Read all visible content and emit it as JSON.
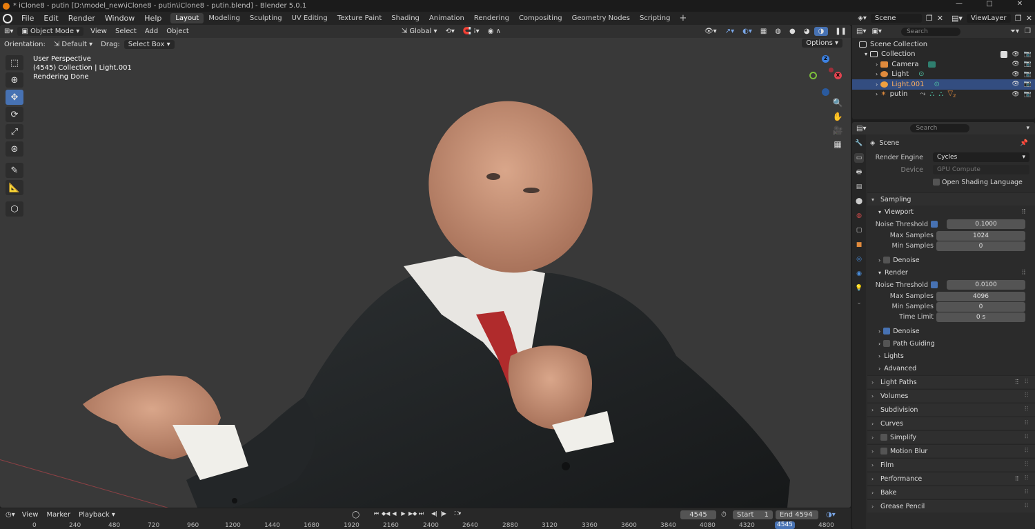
{
  "window": {
    "title": "* iClone8 - putin [D:\\model_new\\iClone8 - putin\\iClone8 - putin.blend] - Blender 5.0.1",
    "controls": [
      "—",
      "□",
      "✕"
    ]
  },
  "menu": [
    "File",
    "Edit",
    "Render",
    "Window",
    "Help"
  ],
  "workspaces": [
    "Layout",
    "Modeling",
    "Sculpting",
    "UV Editing",
    "Texture Paint",
    "Shading",
    "Animation",
    "Rendering",
    "Compositing",
    "Geometry Nodes",
    "Scripting"
  ],
  "active_workspace": "Layout",
  "scene": "Scene",
  "view_layer": "ViewLayer",
  "viewport": {
    "mode": "Object Mode",
    "menus": [
      "View",
      "Select",
      "Add",
      "Object"
    ],
    "transform_orientation": "Global",
    "orientation_label": "Orientation:",
    "orientation_value": "Default",
    "drag_label": "Drag:",
    "drag_value": "Select Box",
    "options": "Options",
    "info_perspective": "User Perspective",
    "info_collection": "(4545) Collection | Light.001",
    "info_status": "Rendering Done",
    "gizmo_axes": [
      "Z",
      "X",
      "Y"
    ]
  },
  "outliner": {
    "search_placeholder": "Search",
    "root": "Scene Collection",
    "collection": "Collection",
    "items": [
      {
        "name": "Camera"
      },
      {
        "name": "Light"
      },
      {
        "name": "Light.001",
        "selected": true
      },
      {
        "name": "putin",
        "badge": "2"
      }
    ]
  },
  "properties": {
    "search_placeholder": "Search",
    "context": "Scene",
    "render_engine_label": "Render Engine",
    "render_engine": "Cycles",
    "device_label": "Device",
    "device": "GPU Compute",
    "osl_label": "Open Shading Language",
    "sampling": "Sampling",
    "viewport_sub": "Viewport",
    "render_sub": "Render",
    "noise_threshold_label": "Noise Threshold",
    "max_samples_label": "Max Samples",
    "min_samples_label": "Min Samples",
    "time_limit_label": "Time Limit",
    "viewport_noise_threshold": "0.1000",
    "viewport_max_samples": "1024",
    "viewport_min_samples": "0",
    "viewport_denoise": "Denoise",
    "render_noise_threshold": "0.0100",
    "render_max_samples": "4096",
    "render_min_samples": "0",
    "render_time_limit": "0 s",
    "render_denoise": "Denoise",
    "path_guiding": "Path Guiding",
    "lights": "Lights",
    "advanced": "Advanced",
    "panels": [
      "Light Paths",
      "Volumes",
      "Subdivision",
      "Curves",
      "Simplify",
      "Motion Blur",
      "Film",
      "Performance",
      "Bake",
      "Grease Pencil"
    ]
  },
  "timeline": {
    "menus": [
      "View",
      "Marker",
      "Playback"
    ],
    "current_frame": "4545",
    "start_label": "Start",
    "start": "1",
    "end_label": "End",
    "end": "4594",
    "ruler": [
      "0",
      "240",
      "480",
      "720",
      "960",
      "1200",
      "1440",
      "1680",
      "1920",
      "2160",
      "2400",
      "2640",
      "2880",
      "3120",
      "3360",
      "3600",
      "3840",
      "4080",
      "4320",
      "4545",
      "4800"
    ]
  },
  "colors": {
    "accent": "#4772b3",
    "selection": "#334d80",
    "viewport_bg": "#393939",
    "axis_x": "#e0434f",
    "axis_y": "#7cbf3c",
    "axis_z": "#3c80e0"
  }
}
